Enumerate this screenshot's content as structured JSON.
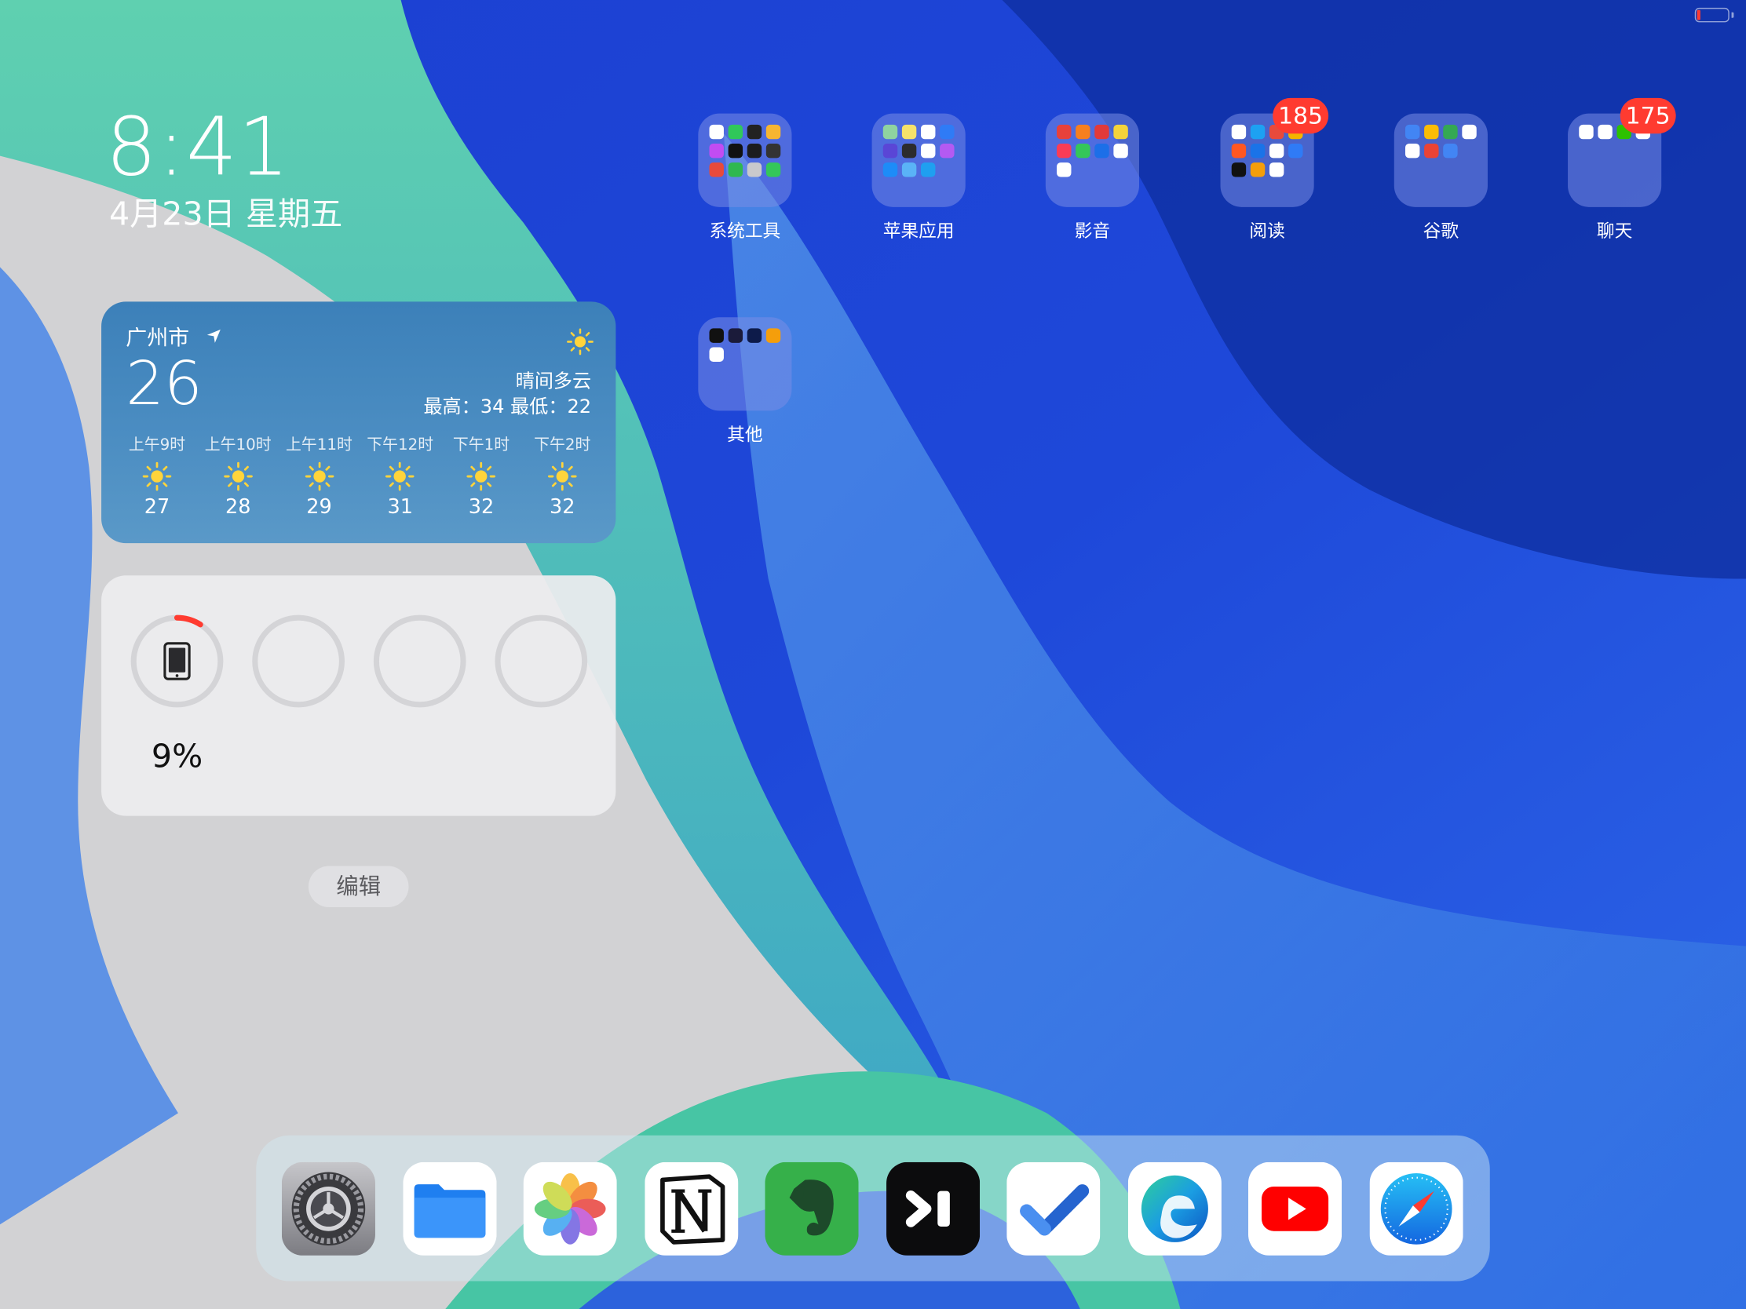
{
  "status_bar": {
    "battery_level_fraction": 0.09,
    "battery_color": "#ff3b30"
  },
  "lock": {
    "time": "8:41",
    "date": "4月23日 星期五"
  },
  "weather": {
    "city": "广州市",
    "temperature": "26",
    "condition": "晴间多云",
    "high_low": "最高：34 最低：22",
    "icon": "sun-icon",
    "hourly": [
      {
        "time": "上午9时",
        "temp": "27"
      },
      {
        "time": "上午10时",
        "temp": "28"
      },
      {
        "time": "上午11时",
        "temp": "29"
      },
      {
        "time": "下午12时",
        "temp": "31"
      },
      {
        "time": "下午1时",
        "temp": "32"
      },
      {
        "time": "下午2时",
        "temp": "32"
      }
    ]
  },
  "battery_widget": {
    "device": "iPad",
    "percent": "9%",
    "level_fraction": 0.09,
    "ring_color": "#ff3b30"
  },
  "edit_button": "编辑",
  "folders": [
    {
      "label": "系统工具",
      "badge": ""
    },
    {
      "label": "苹果应用",
      "badge": ""
    },
    {
      "label": "影音",
      "badge": ""
    },
    {
      "label": "阅读",
      "badge": "185"
    },
    {
      "label": "谷歌",
      "badge": ""
    },
    {
      "label": "聊天",
      "badge": "175"
    },
    {
      "label": "其他",
      "badge": ""
    }
  ],
  "dock": [
    "settings-icon",
    "files-icon",
    "photos-icon",
    "notion-icon",
    "evernote-icon",
    "codepoint-icon",
    "todo-icon",
    "edge-icon",
    "youtube-icon",
    "safari-icon"
  ]
}
